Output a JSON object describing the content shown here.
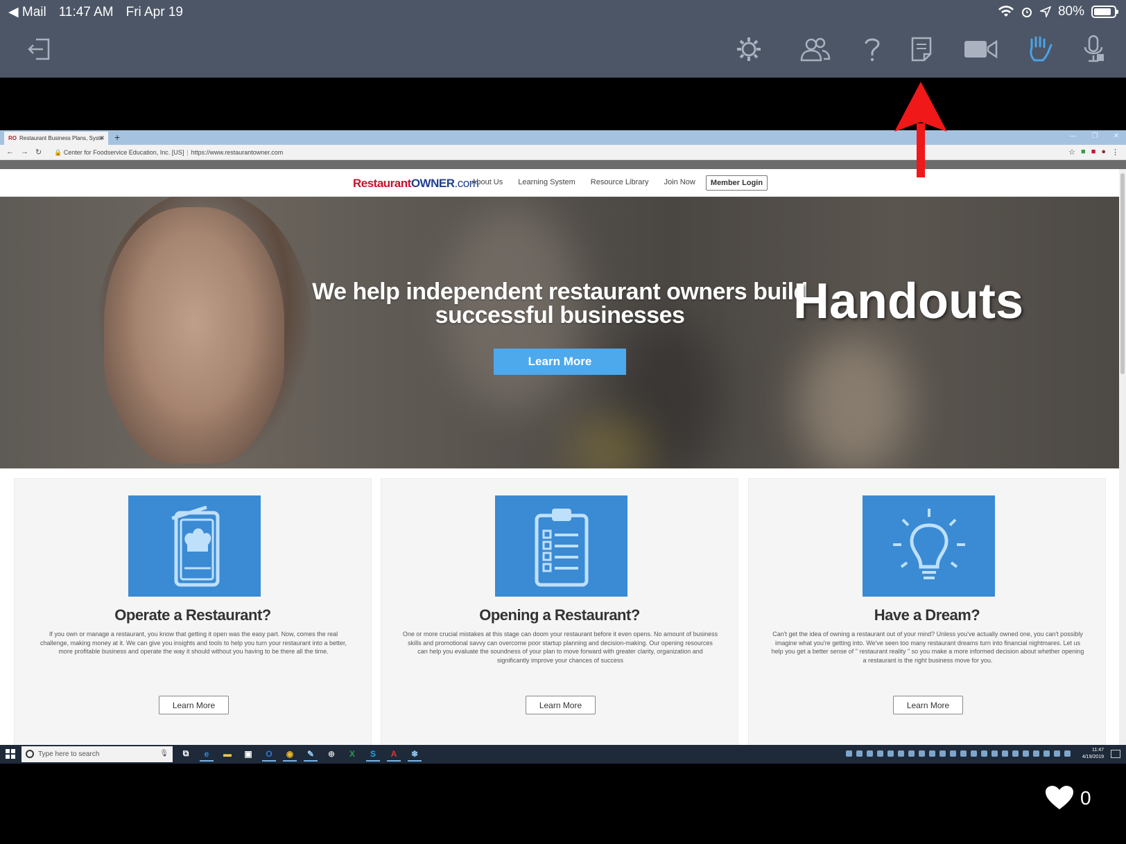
{
  "status_bar": {
    "back_app": "Mail",
    "time": "11:47 AM",
    "date": "Fri Apr 19",
    "battery": "80%"
  },
  "toolbar": {
    "icons": [
      "exit-icon",
      "settings-icon",
      "participants-icon",
      "help-icon",
      "handouts-icon",
      "camera-icon",
      "raise-hand-icon",
      "microphone-icon"
    ],
    "accent_color": "#4aa3e8"
  },
  "browser": {
    "tab_title": "Restaurant Business Plans, Syste",
    "tab_favicon": "RO",
    "site_identity": "Center for Foodservice Education, Inc. [US]",
    "url": "https://www.restaurantowner.com"
  },
  "site": {
    "logo": {
      "part1": "Restaurant",
      "part2": "OWNER",
      "part3": ".com"
    },
    "nav": [
      "About Us",
      "Learning System",
      "Resource Library",
      "Join Now"
    ],
    "member_login": "Member Login",
    "hero_title": "We help independent restaurant owners build successful businesses",
    "hero_button": "Learn More",
    "cards": [
      {
        "icon": "menu-chef-hat-icon",
        "title": "Operate a Restaurant?",
        "text": "If you own or manage a restaurant, you know that getting it open was the easy part. Now, comes the real challenge, making money at it. We can give you insights and tools to help you turn your restaurant into a better, more profitable business and operate the way it should without you having to be there all the time.",
        "button": "Learn More"
      },
      {
        "icon": "clipboard-checklist-icon",
        "title": "Opening a Restaurant?",
        "text": "One or more crucial mistakes at this stage can doom your restaurant before it even opens. No amount of business skills and promotional savvy can overcome poor startup planning and decision-making. Our opening resources can help you evaluate the soundness of your plan to move forward with greater clarity, organization and significantly improve your chances of success",
        "button": "Learn More"
      },
      {
        "icon": "lightbulb-icon",
        "title": "Have a Dream?",
        "text": "Can't get the idea of owning a restaurant out of your mind? Unless you've actually owned one, you can't possibly imagine what you're getting into. We've seen too many restaurant dreams turn into financial nightmares. Let us help you get a better sense of \" restaurant reality \" so you make a more informed decision about whether opening a restaurant is the right business move for you.",
        "button": "Learn More"
      }
    ]
  },
  "overlay_label": "Handouts",
  "taskbar": {
    "search_placeholder": "Type here to search",
    "clock_time": "11:47",
    "clock_date": "4/19/2019"
  },
  "likes": {
    "count": "0"
  }
}
